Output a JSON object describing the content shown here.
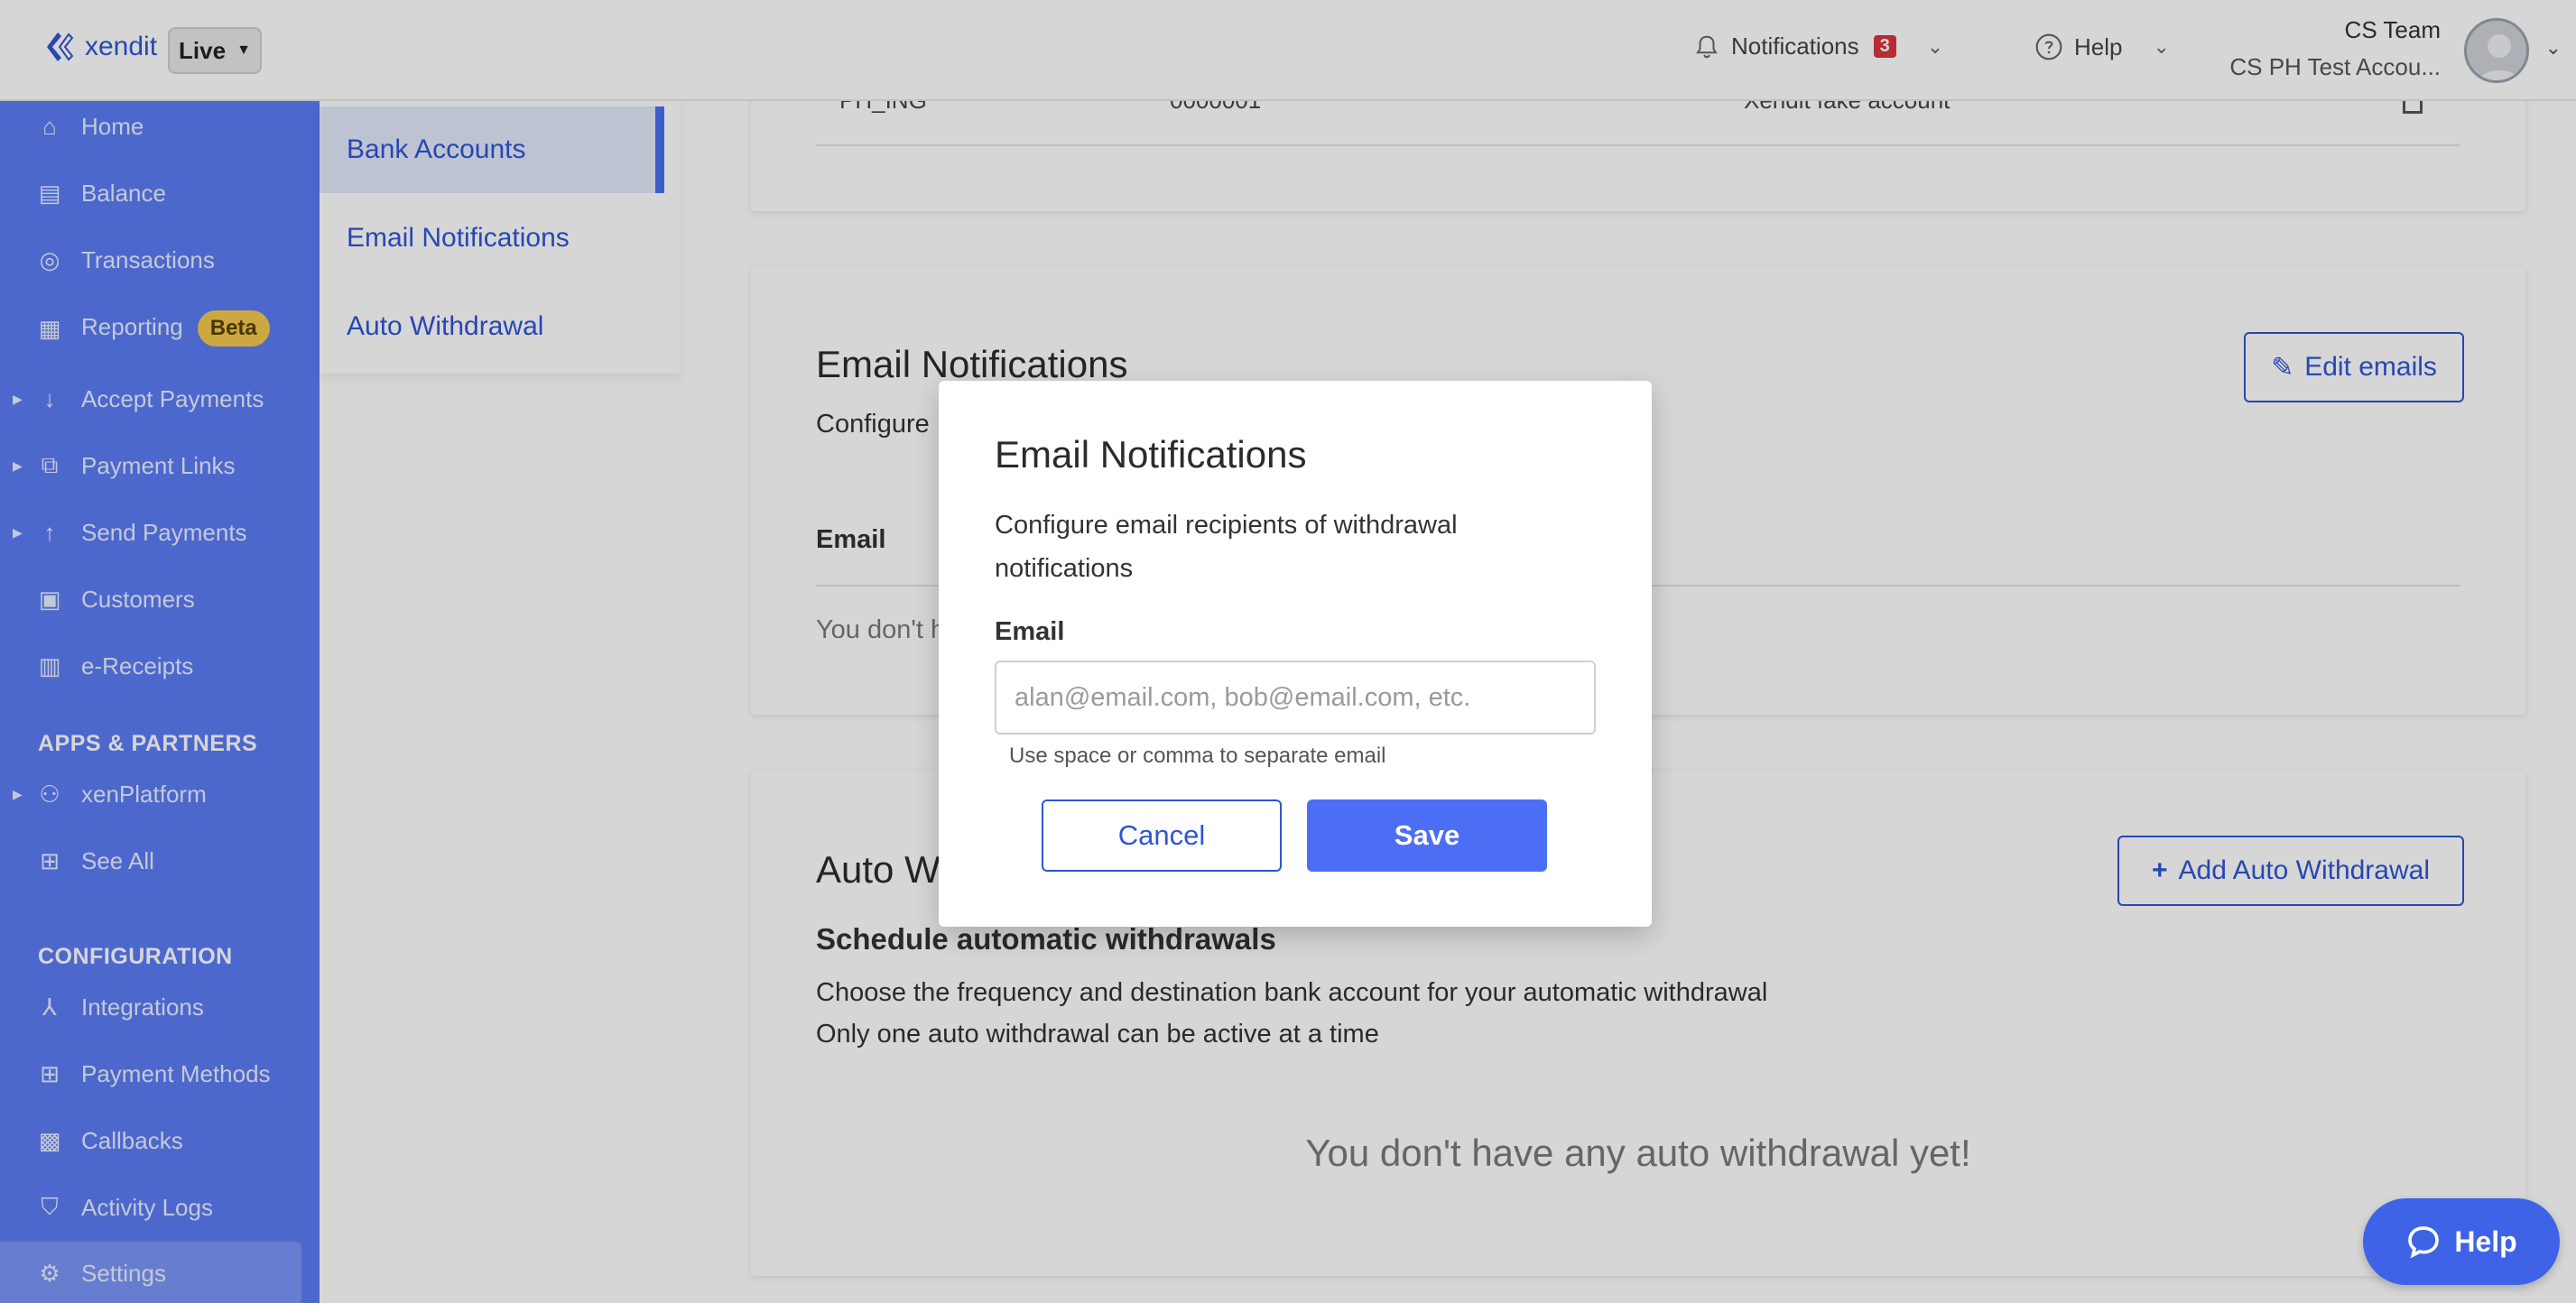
{
  "topbar": {
    "brand": "xendit",
    "environment": "Live",
    "notifications_label": "Notifications",
    "notifications_count": "3",
    "help_label": "Help",
    "user_name": "CS Team",
    "user_org": "CS PH Test Accou..."
  },
  "sidebar": {
    "items": [
      {
        "label": "Home",
        "icon": "home-icon"
      },
      {
        "label": "Balance",
        "icon": "balance-icon"
      },
      {
        "label": "Transactions",
        "icon": "transactions-icon"
      },
      {
        "label": "Reporting",
        "icon": "reporting-icon",
        "badge": "Beta"
      },
      {
        "label": "Accept Payments",
        "icon": "accept-payments-icon"
      },
      {
        "label": "Payment Links",
        "icon": "payment-links-icon"
      },
      {
        "label": "Send Payments",
        "icon": "send-payments-icon"
      },
      {
        "label": "Customers",
        "icon": "customers-icon"
      },
      {
        "label": "e-Receipts",
        "icon": "e-receipts-icon"
      }
    ],
    "apps_title": "APPS & PARTNERS",
    "apps_items": [
      {
        "label": "xenPlatform",
        "icon": "xenplatform-icon"
      },
      {
        "label": "See All",
        "icon": "see-all-icon"
      }
    ],
    "config_title": "CONFIGURATION",
    "config_items": [
      {
        "label": "Integrations",
        "icon": "integrations-icon"
      },
      {
        "label": "Payment Methods",
        "icon": "payment-methods-icon"
      },
      {
        "label": "Callbacks",
        "icon": "callbacks-icon"
      },
      {
        "label": "Activity Logs",
        "icon": "activity-logs-icon"
      },
      {
        "label": "Settings",
        "icon": "settings-icon"
      }
    ]
  },
  "subnav": {
    "items": [
      "Bank Accounts",
      "Email Notifications",
      "Auto Withdrawal"
    ]
  },
  "bank_card": {
    "row_bank": "PH_ING",
    "row_number": "0000001",
    "row_name": "Xendit fake account"
  },
  "email_card": {
    "title": "Email Notifications",
    "desc_prefix": "Configure",
    "edit_button": "Edit emails",
    "column_email": "Email",
    "empty_prefix": "You don't h"
  },
  "auto_card": {
    "title_prefix": "Auto W",
    "add_button": "Add Auto Withdrawal",
    "subtitle": "Schedule automatic withdrawals",
    "line1": "Choose the frequency and destination bank account for your automatic withdrawal",
    "line2": "Only one auto withdrawal can be active at a time",
    "empty": "You don't have any auto withdrawal yet!"
  },
  "modal": {
    "title": "Email Notifications",
    "description": "Configure email recipients of withdrawal notifications",
    "email_label": "Email",
    "email_value": "",
    "email_placeholder": "alan@email.com, bob@email.com, etc.",
    "hint": "Use space or comma to separate email",
    "cancel": "Cancel",
    "save": "Save"
  },
  "help_widget": {
    "label": "Help"
  },
  "colors": {
    "sidebar": "#5b7cf5",
    "accent": "#2f55d4",
    "primary_button": "#4c6ef5",
    "badge": "#d9343f",
    "beta": "#f3c94f"
  }
}
